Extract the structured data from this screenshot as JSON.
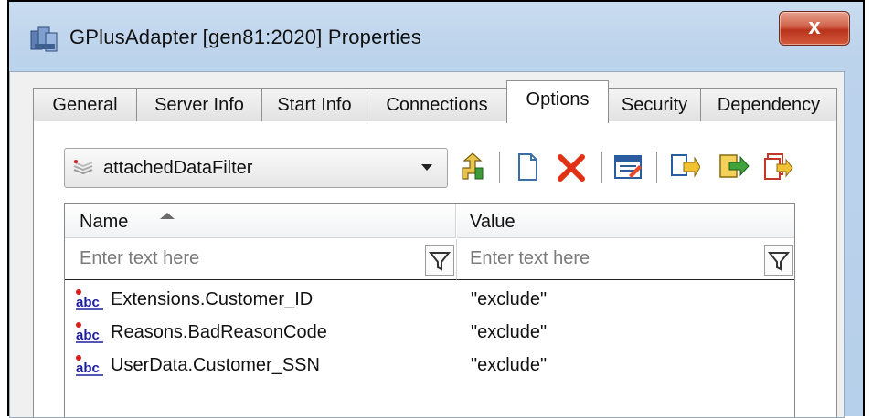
{
  "window": {
    "title": "GPlusAdapter [gen81:2020] Properties",
    "close_label": "x"
  },
  "tabs": [
    {
      "label": "General",
      "active": false
    },
    {
      "label": "Server Info",
      "active": false
    },
    {
      "label": "Start Info",
      "active": false
    },
    {
      "label": "Connections",
      "active": false
    },
    {
      "label": "Options",
      "active": true
    },
    {
      "label": "Security",
      "active": false
    },
    {
      "label": "Dependency",
      "active": false
    }
  ],
  "section_selector": {
    "value": "attachedDataFilter"
  },
  "toolbar": {
    "icons": [
      "upload-icon",
      "new-document-icon",
      "delete-icon",
      "edit-icon",
      "copy-icon",
      "export-icon",
      "import-icon"
    ]
  },
  "grid": {
    "columns": {
      "name": "Name",
      "value": "Value"
    },
    "filter_placeholder": "Enter text here",
    "rows": [
      {
        "name": "Extensions.Customer_ID",
        "value": "\"exclude\""
      },
      {
        "name": "Reasons.BadReasonCode",
        "value": "\"exclude\""
      },
      {
        "name": "UserData.Customer_SSN",
        "value": "\"exclude\""
      }
    ]
  },
  "colors": {
    "title_bar": "#bcd3ec",
    "close_button": "#c74a32",
    "delete_icon": "#e23216",
    "string_icon": "#1e1e9c"
  }
}
